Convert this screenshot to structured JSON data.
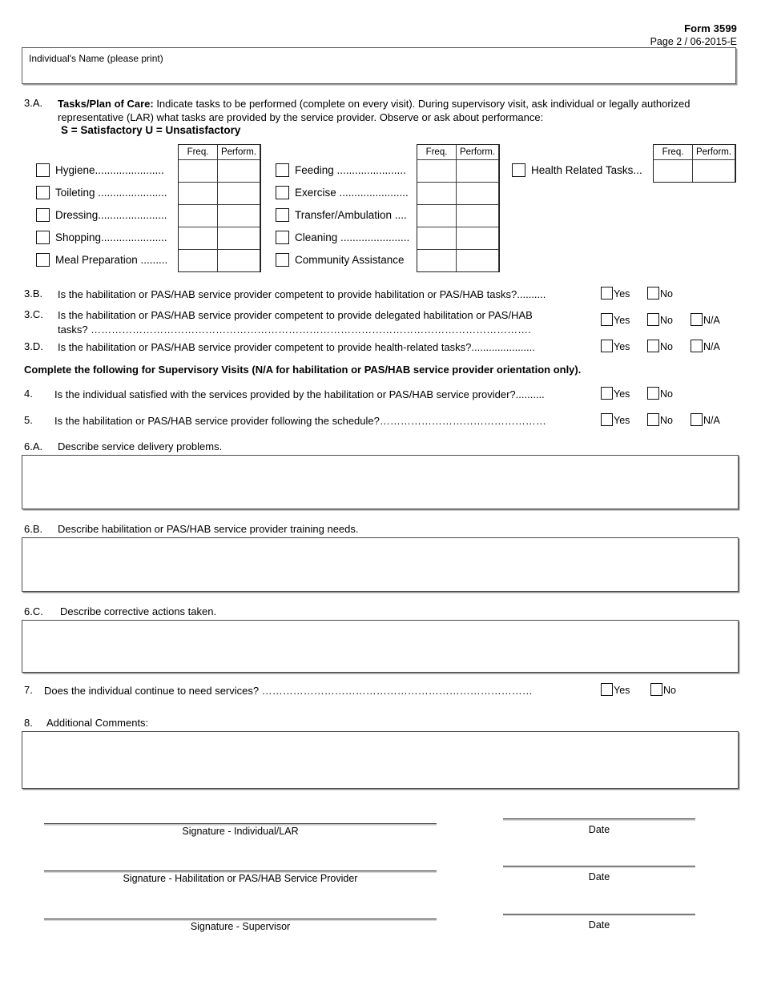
{
  "header": {
    "form_number": "Form 3599",
    "page_line": "Page 2  / 06-2015-E"
  },
  "name_box": {
    "label": "Individual's Name (please print)"
  },
  "section_3a": {
    "number": "3.A.",
    "lead_bold": "Tasks/Plan of Care:",
    "body": " Indicate tasks to be performed (complete on every visit). During supervisory visit, ask individual or legally authorized representative (LAR) what tasks are provided by the service provider. Observe or ask about performance:",
    "scale_line": "S = Satisfactory   U = Unsatisfactory",
    "table_headers": {
      "freq": "Freq.",
      "perform": "Perform."
    },
    "column1": [
      "Hygiene.......................",
      "Toileting .......................",
      "Dressing.......................",
      "Shopping......................",
      "Meal Preparation ........."
    ],
    "column2": [
      "Feeding .......................",
      "Exercise .......................",
      "Transfer/Ambulation ....",
      "Cleaning .......................",
      "Community Assistance"
    ],
    "column3": [
      "Health Related Tasks..."
    ]
  },
  "questions": [
    {
      "number": "3.B.",
      "text": "Is the habilitation or PAS/HAB service provider competent to provide habilitation or PAS/HAB tasks?..........",
      "options": [
        "Yes",
        "No"
      ]
    },
    {
      "number": "3.C.",
      "line1": "Is the habilitation or PAS/HAB service provider competent to provide delegated habilitation or PAS/HAB",
      "line2": "tasks? ……………………………………………………………………………………………………………….",
      "options": [
        "Yes",
        "No",
        "N/A"
      ]
    },
    {
      "number": "3.D.",
      "text": "Is the habilitation or PAS/HAB service provider competent to provide health-related tasks?......................",
      "options": [
        "Yes",
        "No",
        "N/A"
      ]
    }
  ],
  "supervisory_heading": "Complete the following for Supervisory Visits (N/A for habilitation or PAS/HAB service provider orientation only).",
  "questions2": [
    {
      "number": "4.",
      "text": "Is the individual satisfied with the services provided by the habilitation or PAS/HAB service provider?..........",
      "options": [
        "Yes",
        "No"
      ]
    },
    {
      "number": "5.",
      "text": "Is the habilitation or PAS/HAB service provider following the schedule?…………………………………………",
      "options": [
        "Yes",
        "No",
        "N/A"
      ]
    }
  ],
  "text_sections": [
    {
      "number": "6.A.",
      "label": "Describe service delivery problems."
    },
    {
      "number": "6.B.",
      "label": "Describe habilitation or PAS/HAB service provider training needs."
    },
    {
      "number": "6.C.",
      "label": "Describe corrective actions taken."
    }
  ],
  "question7": {
    "number": "7.",
    "text": "Does the individual continue to need services? ……………………………………………………………………",
    "options": [
      "Yes",
      "No"
    ]
  },
  "question8": {
    "number": "8.",
    "label": "Additional Comments:"
  },
  "signatures": [
    {
      "caption": "Signature  - Individual/LAR",
      "date_caption": "Date"
    },
    {
      "caption": "Signature  - Habilitation or PAS/HAB Service Provider",
      "date_caption": "Date"
    },
    {
      "caption": "Signature  - Supervisor",
      "date_caption": "Date"
    }
  ]
}
